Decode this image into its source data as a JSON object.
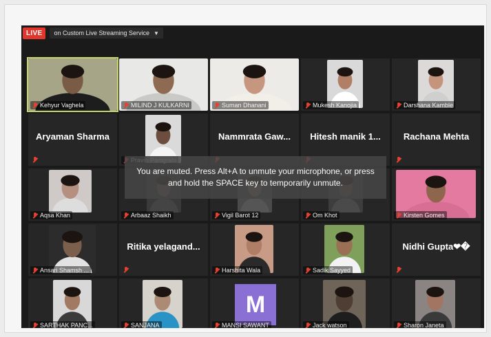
{
  "topbar": {
    "live_label": "LIVE",
    "stream_label": "on Custom Live Streaming Service"
  },
  "participants": [
    {
      "name": "Kehyur Vaghela",
      "video": true,
      "bg": "#a6a588",
      "skin": "#7a5b46",
      "shirt": "#1d1d1d"
    },
    {
      "name": "MILIND J KULKARNI",
      "video": true,
      "bg": "#e8e8e6",
      "skin": "#8e6a52",
      "shirt": "#c9c9c6"
    },
    {
      "name": "Suman Dhanani",
      "video": true,
      "bg": "#ecebe7",
      "skin": "#c6977e",
      "shirt": "#f1efe7"
    },
    {
      "name": "Mukesh Kanojia",
      "video": true,
      "bg": "#d9d9d9",
      "skin": "#b07f65",
      "shirt": "#ffffff"
    },
    {
      "name": "Darshana Kamble",
      "video": true,
      "bg": "#dbdad8",
      "skin": "#c4957c",
      "shirt": "#cfcfcf"
    },
    {
      "name": "Aryaman Sharma",
      "video": false
    },
    {
      "name": "Pravin Panigrahi",
      "video": true,
      "bg": "#dadada",
      "skin": "#6d4e3e",
      "shirt": "#f4f4f4"
    },
    {
      "name": "Nammrata Gaw...",
      "video": false
    },
    {
      "name": "Hitesh manik 1...",
      "video": false
    },
    {
      "name": "Rachana Mehta",
      "video": false
    },
    {
      "name": "Aqsa Khan",
      "video": true,
      "bg": "#cfcac7",
      "skin": "#b58f80",
      "shirt": "#dddddd"
    },
    {
      "name": "Arbaaz Shaikh",
      "video": true,
      "bg": "#3a3a3a",
      "skin": "#6c5a50",
      "shirt": "#444444"
    },
    {
      "name": "Vigil Barot 12",
      "video": true,
      "bg": "#4a4a4a",
      "skin": "#8a7260",
      "shirt": "#555555"
    },
    {
      "name": "Om Khot",
      "video": true,
      "bg": "#3d3d3d",
      "skin": "#665447",
      "shirt": "#4a4a4a"
    },
    {
      "name": "Kirsten Gomes",
      "video": true,
      "bg": "#e57aa0",
      "skin": "#8e664e",
      "shirt": "#d86e93"
    },
    {
      "name": "Ansari Shamsh ...",
      "video": true,
      "bg": "#2c2c2c",
      "skin": "#7b5f4c",
      "shirt": "#e2e2e2"
    },
    {
      "name": "Ritika yelagand...",
      "video": false
    },
    {
      "name": "Harshita Wala",
      "video": true,
      "bg": "#c89b86",
      "skin": "#b07e67",
      "shirt": "#2a2a2a"
    },
    {
      "name": "Sadik Sayyed",
      "video": true,
      "bg": "#7ea05b",
      "skin": "#9a7055",
      "shirt": "#f2f2f2"
    },
    {
      "name": "Nidhi Gupta❤�",
      "video": false
    },
    {
      "name": "SARTHAK PANC...",
      "video": true,
      "bg": "#d8d8d8",
      "skin": "#a27a63",
      "shirt": "#3b3b3b"
    },
    {
      "name": "SANJANA",
      "video": true,
      "bg": "#d6d2cc",
      "skin": "#ad8a73",
      "shirt": "#2a93c6"
    },
    {
      "name": "MANSI SAWANT",
      "video": false,
      "avatar": "M",
      "avatar_color": "#8a6fd4"
    },
    {
      "name": "Jack watson",
      "video": true,
      "bg": "#6e6458",
      "skin": "#4e3e33",
      "shirt": "#1e1e1e"
    },
    {
      "name": "Sharon Janeta",
      "video": true,
      "bg": "#8a8582",
      "skin": "#a27563",
      "shirt": "#3a3a3a"
    }
  ],
  "toast": {
    "message": "You are muted. Press Alt+A to unmute your microphone, or press and hold the SPACE key to temporarily unmute."
  }
}
